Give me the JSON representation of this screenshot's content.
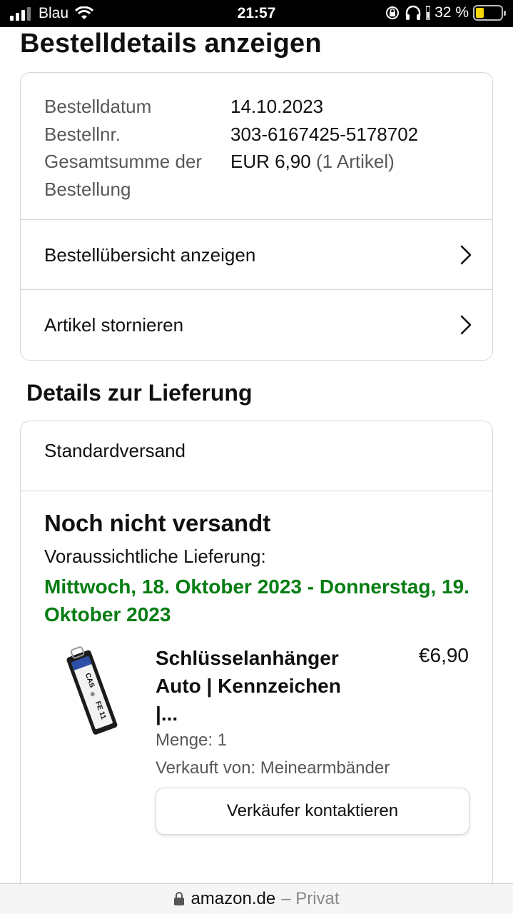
{
  "status_bar": {
    "carrier": "Blau",
    "time": "21:57",
    "battery_percent": "32 %",
    "battery_level": 0.32,
    "icons": [
      "signal-icon",
      "wifi-icon",
      "rotation-lock-icon",
      "headphones-icon",
      "battery-icon"
    ]
  },
  "page": {
    "title": "Bestelldetails anzeigen"
  },
  "order_summary": {
    "rows": [
      {
        "label": "Bestelldatum",
        "value": "14.10.2023"
      },
      {
        "label": "Bestellnr.",
        "value": "303-6167425-5178702"
      },
      {
        "label": "Gesamtsumme der Bestellung",
        "value": "EUR 6,90",
        "extra": "(1 Artikel)"
      }
    ],
    "links": [
      {
        "label": "Bestellübersicht anzeigen"
      },
      {
        "label": "Artikel stornieren"
      }
    ]
  },
  "delivery": {
    "section_title": "Details zur Lieferung",
    "shipping_type": "Standardversand",
    "status": "Noch nicht versandt",
    "eta_label": "Voraussichtliche Lieferung:",
    "eta_dates": "Mittwoch, 18. Oktober 2023 - Donnerstag, 19. Oktober 2023",
    "eta_color": "#067d12"
  },
  "product": {
    "title": "Schlüsselanhänger Auto | Kennzeichen |...",
    "price": "€6,90",
    "quantity": "Menge: 1",
    "seller": "Verkauft von: Meinearmbänder",
    "contact_button": "Verkäufer kontaktieren",
    "plate_text_1": "CAS",
    "plate_text_2": "FE 11"
  },
  "url_bar": {
    "domain": "amazon.de",
    "private_label": "– Privat"
  }
}
